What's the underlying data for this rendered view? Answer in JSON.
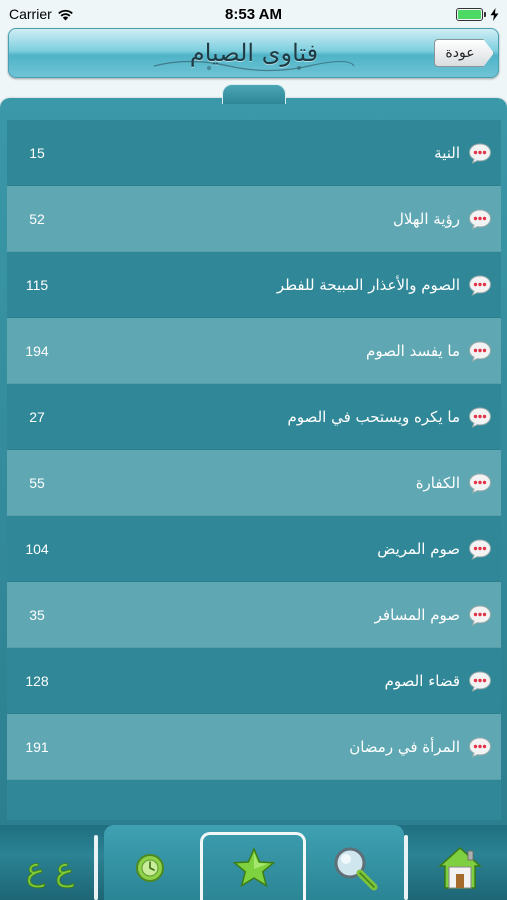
{
  "status_bar": {
    "carrier": "Carrier",
    "time": "8:53 AM"
  },
  "header": {
    "title": "فتاوى الصيام",
    "back_label": "عودة"
  },
  "list": {
    "items": [
      {
        "label": "النية",
        "count": "15"
      },
      {
        "label": "رؤية الهلال",
        "count": "52"
      },
      {
        "label": "الصوم والأعذار المبيحة للفطر",
        "count": "115"
      },
      {
        "label": "ما يفسد الصوم",
        "count": "194"
      },
      {
        "label": "ما يكره ويستحب في الصوم",
        "count": "27"
      },
      {
        "label": "الكفارة",
        "count": "55"
      },
      {
        "label": "صوم المريض",
        "count": "104"
      },
      {
        "label": "صوم المسافر",
        "count": "35"
      },
      {
        "label": "قضاء الصوم",
        "count": "128"
      },
      {
        "label": "المرأة في رمضان",
        "count": "191"
      }
    ]
  },
  "tabbar": {
    "tabs": [
      {
        "icon": "arabic-letters-icon",
        "label": "ع ع"
      },
      {
        "icon": "clock-icon"
      },
      {
        "icon": "star-icon"
      },
      {
        "icon": "magnifier-icon"
      },
      {
        "icon": "home-icon"
      }
    ]
  },
  "colors": {
    "row_dark": "#2f8797",
    "row_light": "#5fa8b3",
    "header_mid": "#4fb3c7"
  }
}
